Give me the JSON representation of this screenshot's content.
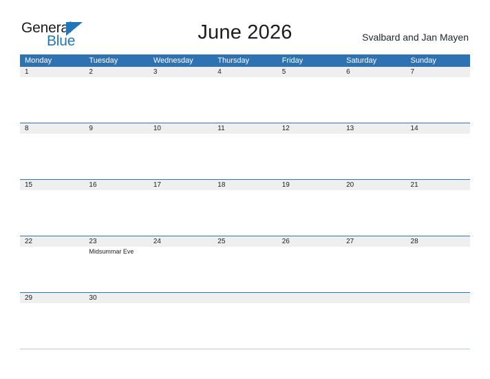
{
  "brand": {
    "name_part1": "General",
    "name_part2": "Blue",
    "triangle_icon": "triangle-logo-icon",
    "accent_color": "#2175bb",
    "text_color": "#1a1a1a"
  },
  "header": {
    "title": "June 2026",
    "region": "Svalbard and Jan Mayen"
  },
  "colors": {
    "header_blue": "#2e72b3",
    "band_gray": "#efefef",
    "row_line": "#2e72b3",
    "text_dark": "#1c1c1c",
    "text_white": "#ffffff"
  },
  "calendar": {
    "month": "June",
    "year": "2026",
    "weekday_headers": [
      "Monday",
      "Tuesday",
      "Wednesday",
      "Thursday",
      "Friday",
      "Saturday",
      "Sunday"
    ],
    "weeks": [
      {
        "days": [
          {
            "num": "1",
            "event": ""
          },
          {
            "num": "2",
            "event": ""
          },
          {
            "num": "3",
            "event": ""
          },
          {
            "num": "4",
            "event": ""
          },
          {
            "num": "5",
            "event": ""
          },
          {
            "num": "6",
            "event": ""
          },
          {
            "num": "7",
            "event": ""
          }
        ]
      },
      {
        "days": [
          {
            "num": "8",
            "event": ""
          },
          {
            "num": "9",
            "event": ""
          },
          {
            "num": "10",
            "event": ""
          },
          {
            "num": "11",
            "event": ""
          },
          {
            "num": "12",
            "event": ""
          },
          {
            "num": "13",
            "event": ""
          },
          {
            "num": "14",
            "event": ""
          }
        ]
      },
      {
        "days": [
          {
            "num": "15",
            "event": ""
          },
          {
            "num": "16",
            "event": ""
          },
          {
            "num": "17",
            "event": ""
          },
          {
            "num": "18",
            "event": ""
          },
          {
            "num": "19",
            "event": ""
          },
          {
            "num": "20",
            "event": ""
          },
          {
            "num": "21",
            "event": ""
          }
        ]
      },
      {
        "days": [
          {
            "num": "22",
            "event": ""
          },
          {
            "num": "23",
            "event": "Midsummar Eve"
          },
          {
            "num": "24",
            "event": ""
          },
          {
            "num": "25",
            "event": ""
          },
          {
            "num": "26",
            "event": ""
          },
          {
            "num": "27",
            "event": ""
          },
          {
            "num": "28",
            "event": ""
          }
        ]
      },
      {
        "days": [
          {
            "num": "29",
            "event": ""
          },
          {
            "num": "30",
            "event": ""
          },
          {
            "num": "",
            "event": ""
          },
          {
            "num": "",
            "event": ""
          },
          {
            "num": "",
            "event": ""
          },
          {
            "num": "",
            "event": ""
          },
          {
            "num": "",
            "event": ""
          }
        ]
      }
    ]
  }
}
